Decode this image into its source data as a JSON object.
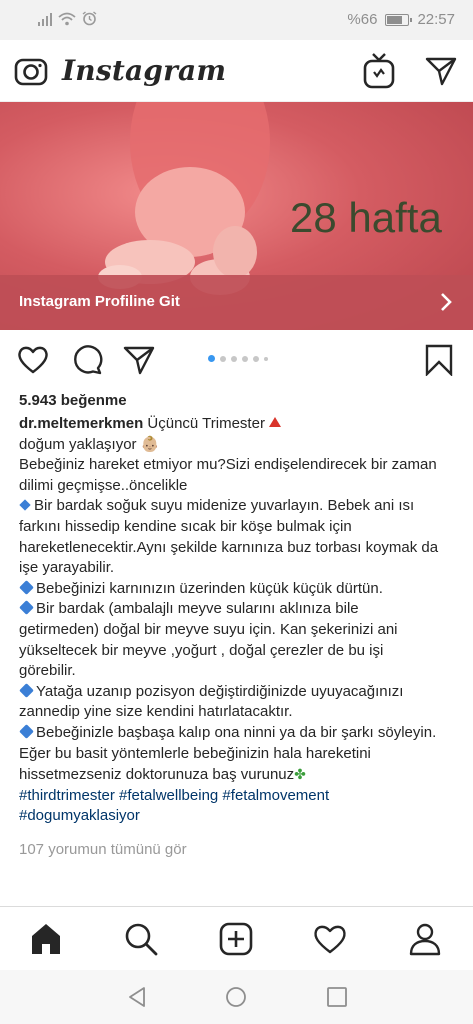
{
  "status_bar": {
    "battery_text": "%66",
    "battery_level": 0.66,
    "time": "22:57"
  },
  "header": {
    "logo": "Instagram",
    "icons": [
      "camera-icon",
      "igtv-icon",
      "direct-message-icon"
    ]
  },
  "post": {
    "media": {
      "overlay_text": "28 hafta",
      "profile_link_label": "Instagram Profiline Git"
    },
    "carousel": {
      "count": 6,
      "active_index": 0
    },
    "likes": "5.943 beğenme",
    "caption": {
      "username": "dr.meltemerkmen",
      "lines": [
        "Üçüncü Trimester",
        "doğum yaklaşıyor 👶🏼",
        "Bebeğiniz hareket etmiyor mu?Sizi endişelendirecek bir zaman",
        "dilimi geçmişse..öncelikle",
        "Bir bardak soğuk suyu midenize yuvarlayın. Bebek ani ısı",
        "farkını hissedip kendine sıcak bir köşe bulmak için",
        "hareketlenecektir.Aynı şekilde karnınıza buz torbası koymak da",
        "işe yarayabilir.",
        "Bebeğinizi karnınızın üzerinden küçük küçük dürtün.",
        "Bir bardak (ambalajlı meyve sularını aklınıza bile",
        "getirmeden) doğal bir meyve suyu için. Kan şekerinizi ani",
        "yükseltecek bir meyve ,yoğurt , doğal çerezler de bu işi",
        "görebilir.",
        "Yatağa uzanıp pozisyon değiştirdiğinizde uyuyacağınızı",
        "zannedip yine size kendini hatırlatacaktır.",
        "Bebeğinizle başbaşa kalıp ona ninni ya da bir şarkı söyleyin.",
        "Eğer bu basit yöntemlerle bebeğinizin hala hareketini",
        "hissetmezseniz doktorunuza baş vurunuz",
        "#thirdtrimester #fetalwellbeing #fetalmovement",
        "#dogumyaklasiyor"
      ]
    },
    "comments_link": "107 yorumun tümünü gör"
  },
  "bottom_nav": {
    "items": [
      "home-icon",
      "search-icon",
      "new-post-icon",
      "activity-heart-icon",
      "profile-icon"
    ]
  },
  "system_nav": {
    "items": [
      "back-icon",
      "home-circle-icon",
      "recents-icon"
    ]
  },
  "colors": {
    "media_overlay": "#be4e56",
    "hashtag": "#003569",
    "carousel_active": "#3897f0",
    "secondary_text": "#999999"
  }
}
